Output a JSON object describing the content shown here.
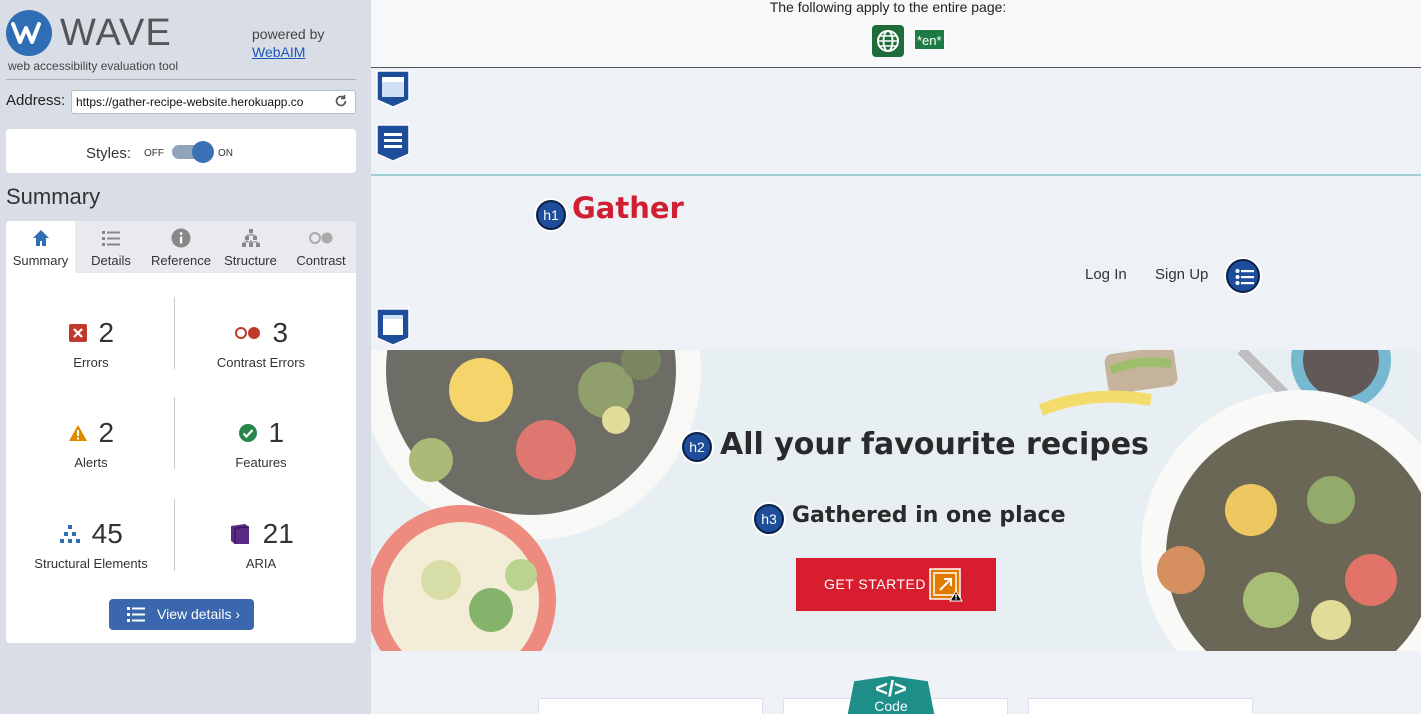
{
  "wave": {
    "brand": "WAVE",
    "tagline": "web accessibility evaluation tool",
    "powered_by": "powered by",
    "webaim": "WebAIM",
    "address_label": "Address:",
    "address_value": "https://gather-recipe-website.herokuapp.co",
    "styles_label": "Styles:",
    "styles_off": "OFF",
    "styles_on": "ON",
    "summary_heading": "Summary",
    "tabs": [
      {
        "label": "Summary",
        "icon": "home-icon"
      },
      {
        "label": "Details",
        "icon": "list-icon"
      },
      {
        "label": "Reference",
        "icon": "info-icon"
      },
      {
        "label": "Structure",
        "icon": "structure-icon"
      },
      {
        "label": "Contrast",
        "icon": "contrast-icon"
      }
    ],
    "stats": {
      "errors": {
        "count": "2",
        "label": "Errors",
        "color": "#c0392b"
      },
      "contrast_errors": {
        "count": "3",
        "label": "Contrast Errors",
        "color": "#c0392b"
      },
      "alerts": {
        "count": "2",
        "label": "Alerts",
        "color": "#e08a00"
      },
      "features": {
        "count": "1",
        "label": "Features",
        "color": "#27874a"
      },
      "structural": {
        "count": "45",
        "label": "Structural Elements",
        "color": "#2f6db5"
      },
      "aria": {
        "count": "21",
        "label": "ARIA",
        "color": "#5b2a86"
      }
    },
    "view_details": "View details ›"
  },
  "page": {
    "applies_text": "The following apply to the entire page:",
    "lang_badge": "*en*",
    "h1_badge": "h1",
    "brand": "Gather",
    "nav": {
      "login": "Log In",
      "signup": "Sign Up"
    },
    "h2_badge": "h2",
    "hero_title": "All your favourite recipes",
    "h3_badge": "h3",
    "hero_subtitle": "Gathered in one place",
    "cta": "GET STARTED",
    "code_badge_symbol": "</>",
    "code_badge_label": "Code"
  }
}
